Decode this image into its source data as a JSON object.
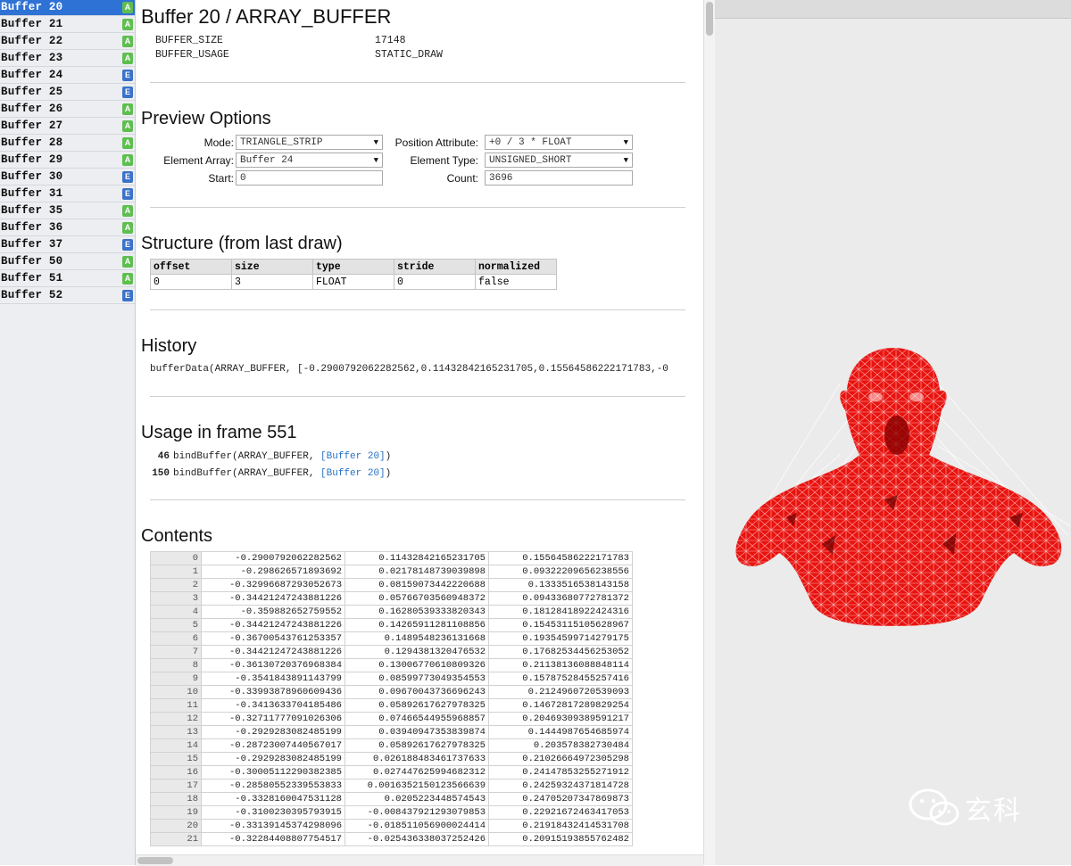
{
  "sidebar": {
    "items": [
      {
        "label": "Buffer 20",
        "badge": "A",
        "selected": true
      },
      {
        "label": "Buffer 21",
        "badge": "A"
      },
      {
        "label": "Buffer 22",
        "badge": "A"
      },
      {
        "label": "Buffer 23",
        "badge": "A"
      },
      {
        "label": "Buffer 24",
        "badge": "E"
      },
      {
        "label": "Buffer 25",
        "badge": "E"
      },
      {
        "label": "Buffer 26",
        "badge": "A"
      },
      {
        "label": "Buffer 27",
        "badge": "A"
      },
      {
        "label": "Buffer 28",
        "badge": "A"
      },
      {
        "label": "Buffer 29",
        "badge": "A"
      },
      {
        "label": "Buffer 30",
        "badge": "E"
      },
      {
        "label": "Buffer 31",
        "badge": "E"
      },
      {
        "label": "Buffer 35",
        "badge": "A"
      },
      {
        "label": "Buffer 36",
        "badge": "A"
      },
      {
        "label": "Buffer 37",
        "badge": "E"
      },
      {
        "label": "Buffer 50",
        "badge": "A"
      },
      {
        "label": "Buffer 51",
        "badge": "A"
      },
      {
        "label": "Buffer 52",
        "badge": "E"
      }
    ]
  },
  "header": {
    "title": "Buffer 20 / ARRAY_BUFFER",
    "props": [
      {
        "key": "BUFFER_SIZE",
        "value": "17148"
      },
      {
        "key": "BUFFER_USAGE",
        "value": "STATIC_DRAW"
      }
    ]
  },
  "preview_options": {
    "heading": "Preview Options",
    "mode_label": "Mode:",
    "mode_value": "TRIANGLE_STRIP",
    "element_array_label": "Element Array:",
    "element_array_value": "Buffer 24",
    "start_label": "Start:",
    "start_value": "0",
    "position_attr_label": "Position Attribute:",
    "position_attr_value": "+0 / 3 * FLOAT",
    "element_type_label": "Element Type:",
    "element_type_value": "UNSIGNED_SHORT",
    "count_label": "Count:",
    "count_value": "3696"
  },
  "structure": {
    "heading": "Structure (from last draw)",
    "columns": [
      "offset",
      "size",
      "type",
      "stride",
      "normalized"
    ],
    "row": [
      "0",
      "3",
      "FLOAT",
      "0",
      "false"
    ]
  },
  "history": {
    "heading": "History",
    "call": "bufferData(ARRAY_BUFFER, [-0.2900792062282562,0.11432842165231705,0.15564586222171783,-0"
  },
  "usage": {
    "heading": "Usage in frame 551",
    "calls": [
      {
        "num": "46",
        "call": "bindBuffer(ARRAY_BUFFER, ",
        "link": "[Buffer 20]",
        "tail": ")"
      },
      {
        "num": "150",
        "call": "bindBuffer(ARRAY_BUFFER, ",
        "link": "[Buffer 20]",
        "tail": ")"
      }
    ]
  },
  "contents": {
    "heading": "Contents",
    "rows": [
      [
        "0",
        "-0.2900792062282562",
        "0.11432842165231705",
        "0.15564586222171783"
      ],
      [
        "1",
        "-0.298626571893692",
        "0.02178148739039898",
        "0.09322209656238556"
      ],
      [
        "2",
        "-0.32996687293052673",
        "0.08159073442220688",
        "0.1333516538143158"
      ],
      [
        "3",
        "-0.34421247243881226",
        "0.05766703560948372",
        "0.09433680772781372"
      ],
      [
        "4",
        "-0.359882652759552",
        "0.16280539333820343",
        "0.18128418922424316"
      ],
      [
        "5",
        "-0.34421247243881226",
        "0.14265911281108856",
        "0.15453115105628967"
      ],
      [
        "6",
        "-0.36700543761253357",
        "0.1489548236131668",
        "0.19354599714279175"
      ],
      [
        "7",
        "-0.34421247243881226",
        "0.1294381320476532",
        "0.17682534456253052"
      ],
      [
        "8",
        "-0.36130720376968384",
        "0.13006770610809326",
        "0.21138136088848114"
      ],
      [
        "9",
        "-0.3541843891143799",
        "0.08599773049354553",
        "0.15787528455257416"
      ],
      [
        "10",
        "-0.33993878960609436",
        "0.09670043736696243",
        "0.2124960720539093"
      ],
      [
        "11",
        "-0.3413633704185486",
        "0.05892617627978325",
        "0.14672817289829254"
      ],
      [
        "12",
        "-0.32711777091026306",
        "0.07466544955968857",
        "0.20469309389591217"
      ],
      [
        "13",
        "-0.2929283082485199",
        "0.03940947353839874",
        "0.1444987654685974"
      ],
      [
        "14",
        "-0.28723007440567017",
        "0.05892617627978325",
        "0.203578382730484"
      ],
      [
        "15",
        "-0.2929283082485199",
        "0.026188483461737633",
        "0.21026664972305298"
      ],
      [
        "16",
        "-0.30005112290382385",
        "0.027447625994682312",
        "0.24147853255271912"
      ],
      [
        "17",
        "-0.28580552339553833",
        "0.0016352150123566639",
        "0.24259324371814728"
      ],
      [
        "18",
        "-0.3328160047531128",
        "0.0205223448574543",
        "0.24705207347869873"
      ],
      [
        "19",
        "-0.3100230395793915",
        "-0.008437921293079853",
        "0.22921672463417053"
      ],
      [
        "20",
        "-0.33139145374298096",
        "-0.018511056900024414",
        "0.21918432414531708"
      ],
      [
        "21",
        "-0.32284408807754517",
        "-0.025436338037252426",
        "0.20915193855762482"
      ]
    ]
  },
  "preview": {
    "watermark_text": "玄科",
    "mesh_color": "#e8130f",
    "accent_color": "#2f72d5"
  }
}
